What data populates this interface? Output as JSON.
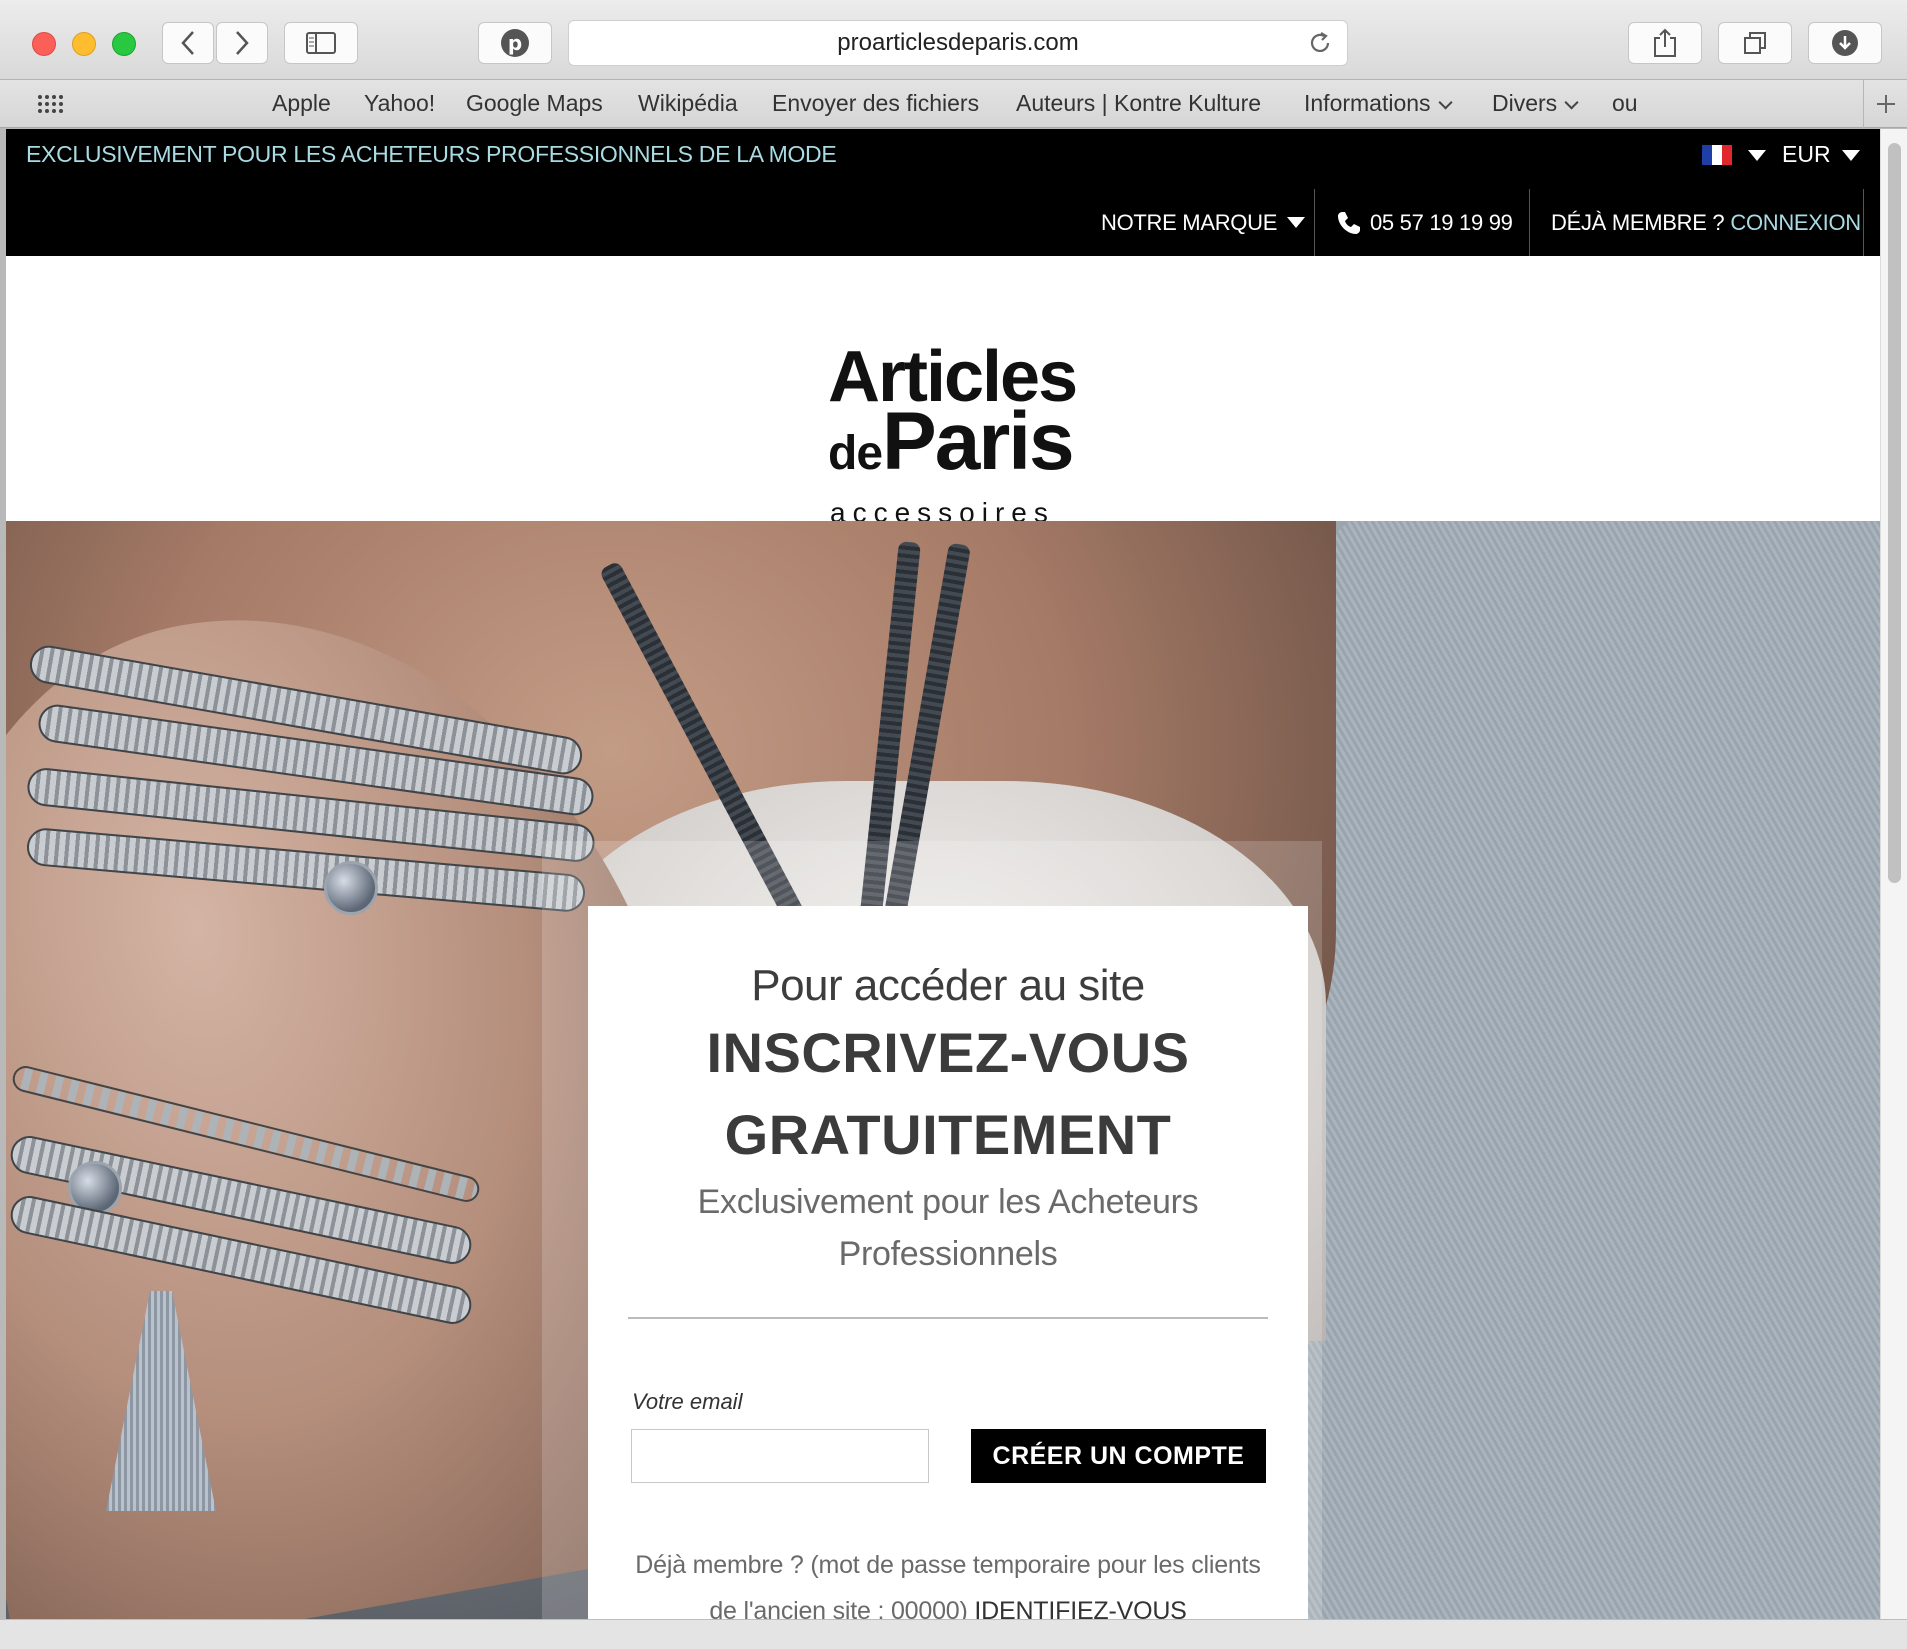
{
  "browser": {
    "url": "proarticlesdeparis.com",
    "favorites": [
      {
        "label": "Apple",
        "dropdown": false
      },
      {
        "label": "Yahoo!",
        "dropdown": false
      },
      {
        "label": "Google Maps",
        "dropdown": false
      },
      {
        "label": "Wikipédia",
        "dropdown": false
      },
      {
        "label": "Envoyer des fichiers",
        "dropdown": false
      },
      {
        "label": "Auteurs | Kontre Kulture",
        "dropdown": false
      },
      {
        "label": "Informations",
        "dropdown": true
      },
      {
        "label": "Divers",
        "dropdown": true
      },
      {
        "label": "ou",
        "dropdown": false
      }
    ],
    "icons": [
      "back-icon",
      "forward-icon",
      "sidebar-icon",
      "pinterest-icon",
      "reload-icon",
      "share-icon",
      "tabs-icon",
      "download-icon",
      "top-sites-grid-icon",
      "new-tab-plus-icon"
    ]
  },
  "site": {
    "topbar_text": "EXCLUSIVEMENT POUR LES ACHETEURS PROFESSIONNELS DE LA MODE",
    "currency": "EUR",
    "nav": {
      "brand": "NOTRE MARQUE",
      "phone": "05 57 19 19 99",
      "member_text": "DÉJÀ MEMBRE ?",
      "login": "CONNEXION"
    },
    "logo": {
      "line1": "Articles",
      "de": "de",
      "paris": "Paris",
      "line3": "accessoires"
    },
    "colors": {
      "accent": "#a9dbe3",
      "bar": "#000000",
      "flag": [
        "#1f3fa6",
        "#ffffff",
        "#e1262d"
      ]
    }
  },
  "signup": {
    "pre_title": "Pour accéder au site",
    "title_line1": "INSCRIVEZ-VOUS",
    "title_line2": "GRATUITEMENT",
    "subtitle_line1": "Exclusivement pour les Acheteurs",
    "subtitle_line2": "Professionnels",
    "email_label": "Votre email",
    "email_value": "",
    "create_button": "CRÉER UN COMPTE",
    "already_text": "Déjà membre ? (mot de passe temporaire pour les clients de l'ancien site : 00000)",
    "identify_link": "IDENTIFIEZ-VOUS"
  }
}
